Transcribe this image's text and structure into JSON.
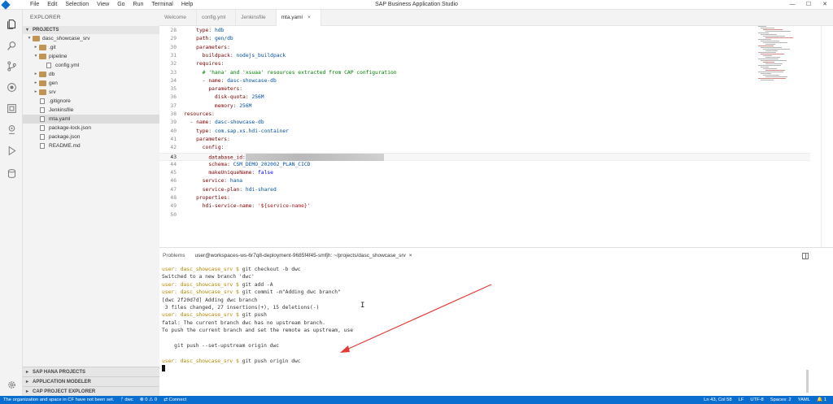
{
  "window": {
    "title": "SAP Business Application Studio",
    "menu": [
      "File",
      "Edit",
      "Selection",
      "View",
      "Go",
      "Run",
      "Terminal",
      "Help"
    ]
  },
  "sidebar": {
    "title": "EXPLORER",
    "projects_label": "PROJECTS",
    "tree": [
      {
        "label": "dasc_showcase_srv",
        "kind": "folder",
        "depth": 0,
        "expanded": true
      },
      {
        "label": ".git",
        "kind": "folder",
        "depth": 1,
        "expanded": false
      },
      {
        "label": "pipeline",
        "kind": "folder",
        "depth": 1,
        "expanded": true
      },
      {
        "label": "config.yml",
        "kind": "file",
        "depth": 2
      },
      {
        "label": "db",
        "kind": "folder",
        "depth": 1,
        "expanded": false
      },
      {
        "label": "gen",
        "kind": "folder",
        "depth": 1,
        "expanded": false
      },
      {
        "label": "srv",
        "kind": "folder",
        "depth": 1,
        "expanded": false
      },
      {
        "label": ".gitignore",
        "kind": "file",
        "depth": 1
      },
      {
        "label": "Jenkinsfile",
        "kind": "file",
        "depth": 1
      },
      {
        "label": "mta.yaml",
        "kind": "file",
        "depth": 1,
        "selected": true
      },
      {
        "label": "package-lock.json",
        "kind": "file",
        "depth": 1
      },
      {
        "label": "package.json",
        "kind": "file",
        "depth": 1
      },
      {
        "label": "README.md",
        "kind": "file",
        "depth": 1
      }
    ],
    "bottom_sections": [
      "SAP HANA PROJECTS",
      "APPLICATION MODELER",
      "CAP PROJECT EXPLORER"
    ]
  },
  "editor_tabs": [
    {
      "label": "Welcome",
      "active": false
    },
    {
      "label": "config.yml",
      "active": false
    },
    {
      "label": "Jenkinsfile",
      "active": false
    },
    {
      "label": "mta.yaml",
      "active": true,
      "close": "×"
    }
  ],
  "code": [
    {
      "n": "28",
      "indent": "    ",
      "tokens": [
        [
          "k",
          "type"
        ],
        [
          "p",
          ": "
        ],
        [
          "v",
          "hdb"
        ]
      ]
    },
    {
      "n": "29",
      "indent": "    ",
      "tokens": [
        [
          "k",
          "path"
        ],
        [
          "p",
          ": "
        ],
        [
          "v",
          "gen/db"
        ]
      ]
    },
    {
      "n": "30",
      "indent": "    ",
      "tokens": [
        [
          "k",
          "parameters"
        ],
        [
          "p",
          ":"
        ]
      ]
    },
    {
      "n": "31",
      "indent": "      ",
      "tokens": [
        [
          "k",
          "buildpack"
        ],
        [
          "p",
          ": "
        ],
        [
          "v",
          "nodejs_buildpack"
        ]
      ]
    },
    {
      "n": "32",
      "indent": "    ",
      "tokens": [
        [
          "k",
          "requires"
        ],
        [
          "p",
          ":"
        ]
      ]
    },
    {
      "n": "33",
      "indent": "      ",
      "tokens": [
        [
          "c",
          "# 'hana' and 'xsuaa' resources extracted from CAP configuration"
        ]
      ]
    },
    {
      "n": "34",
      "indent": "      ",
      "tokens": [
        [
          "p",
          "- "
        ],
        [
          "k",
          "name"
        ],
        [
          "p",
          ": "
        ],
        [
          "v",
          "dasc-showcase-db"
        ]
      ]
    },
    {
      "n": "35",
      "indent": "        ",
      "tokens": [
        [
          "k",
          "parameters"
        ],
        [
          "p",
          ":"
        ]
      ]
    },
    {
      "n": "36",
      "indent": "          ",
      "tokens": [
        [
          "k",
          "disk-quota"
        ],
        [
          "p",
          ": "
        ],
        [
          "v",
          "256M"
        ]
      ]
    },
    {
      "n": "37",
      "indent": "          ",
      "tokens": [
        [
          "k",
          "memory"
        ],
        [
          "p",
          ": "
        ],
        [
          "v",
          "256M"
        ]
      ]
    },
    {
      "n": "38",
      "indent": "",
      "tokens": [
        [
          "k",
          "resources"
        ],
        [
          "p",
          ":"
        ]
      ]
    },
    {
      "n": "39",
      "indent": "  ",
      "tokens": [
        [
          "p",
          "- "
        ],
        [
          "k",
          "name"
        ],
        [
          "p",
          ": "
        ],
        [
          "v",
          "dasc-showcase-db"
        ]
      ]
    },
    {
      "n": "40",
      "indent": "    ",
      "tokens": [
        [
          "k",
          "type"
        ],
        [
          "p",
          ": "
        ],
        [
          "v",
          "com.sap.xs.hdi-container"
        ]
      ]
    },
    {
      "n": "41",
      "indent": "    ",
      "tokens": [
        [
          "k",
          "parameters"
        ],
        [
          "p",
          ":"
        ]
      ]
    },
    {
      "n": "42",
      "indent": "      ",
      "tokens": [
        [
          "k",
          "config"
        ],
        [
          "p",
          ":"
        ]
      ]
    },
    {
      "n": "43",
      "indent": "        ",
      "tokens": [
        [
          "k",
          "database_id"
        ],
        [
          "p",
          ":"
        ],
        [
          "r",
          ""
        ]
      ],
      "current": true
    },
    {
      "n": "44",
      "indent": "        ",
      "tokens": [
        [
          "k",
          "schema"
        ],
        [
          "p",
          ": "
        ],
        [
          "v",
          "CSM_DEMO_202002_PLAN_CICD"
        ]
      ]
    },
    {
      "n": "45",
      "indent": "        ",
      "tokens": [
        [
          "k",
          "makeUniqueName"
        ],
        [
          "p",
          ": "
        ],
        [
          "b",
          "false"
        ]
      ]
    },
    {
      "n": "46",
      "indent": "      ",
      "tokens": [
        [
          "k",
          "service"
        ],
        [
          "p",
          ": "
        ],
        [
          "v",
          "hana"
        ]
      ]
    },
    {
      "n": "47",
      "indent": "      ",
      "tokens": [
        [
          "k",
          "service-plan"
        ],
        [
          "p",
          ": "
        ],
        [
          "v",
          "hdi-shared"
        ]
      ]
    },
    {
      "n": "48",
      "indent": "    ",
      "tokens": [
        [
          "k",
          "properties"
        ],
        [
          "p",
          ":"
        ]
      ]
    },
    {
      "n": "49",
      "indent": "      ",
      "tokens": [
        [
          "k",
          "hdi-service-name"
        ],
        [
          "p",
          ": "
        ],
        [
          "s",
          "'${service-name}'"
        ]
      ]
    },
    {
      "n": "50",
      "indent": "",
      "tokens": []
    }
  ],
  "panel": {
    "tabs": [
      {
        "label": "Problems",
        "active": false
      },
      {
        "label": "user@workspaces-ws-6r7q8-deployment-9685f4f45-smfjh: ~/projects/dasc_showcase_srv",
        "active": true,
        "close": "×"
      }
    ],
    "terminal": [
      {
        "prompt": "user: dasc_showcase_srv $",
        "text": " git checkout -b dwc"
      },
      {
        "text": "Switched to a new branch 'dwc'"
      },
      {
        "prompt": "user: dasc_showcase_srv $",
        "text": " git add -A"
      },
      {
        "prompt": "user: dasc_showcase_srv $",
        "text": " git commit -m\"Adding dwc branch\""
      },
      {
        "text": "[dwc 2f20d7d] Adding dwc branch"
      },
      {
        "text": " 3 files changed, 27 insertions(+), 15 deletions(-)"
      },
      {
        "prompt": "user: dasc_showcase_srv $",
        "text": " git push"
      },
      {
        "text": "fatal: The current branch dwc has no upstream branch."
      },
      {
        "text": "To push the current branch and set the remote as upstream, use"
      },
      {
        "text": ""
      },
      {
        "text": "    git push --set-upstream origin dwc"
      },
      {
        "text": ""
      },
      {
        "prompt": "user: dasc_showcase_srv $",
        "text": " git push origin dwc"
      }
    ]
  },
  "statusbar": {
    "left": [
      "The organization and space in CF have not been set.",
      "ᚠ dwc",
      "⊗ 0 ⚠ 0",
      "⇄ Connect"
    ],
    "right": [
      "Ln 43, Col 58",
      "LF",
      "UTF-8",
      "Spaces: 2",
      "YAML",
      "🔔 1"
    ]
  },
  "colors": {
    "accent": "#0a6ed1",
    "annotation_arrow": "#e53935"
  }
}
